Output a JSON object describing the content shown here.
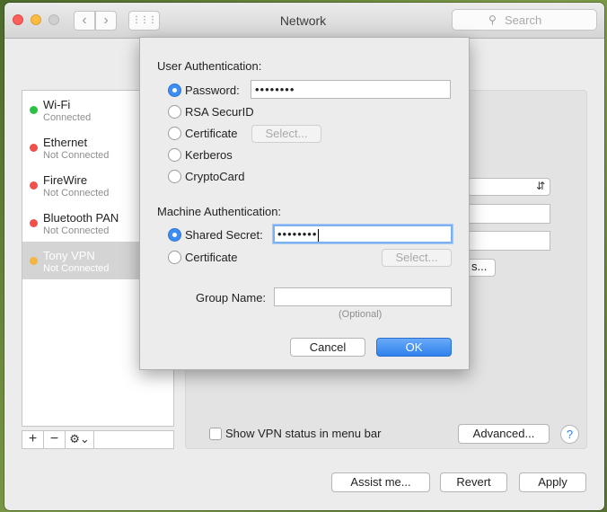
{
  "window": {
    "title": "Network"
  },
  "search": {
    "placeholder": "Search",
    "icon": "magnifier"
  },
  "toolbar": {
    "back": "‹",
    "forward": "›",
    "grid": "⋮⋮⋮"
  },
  "sidebar": {
    "items": [
      {
        "name": "Wi-Fi",
        "status": "Connected",
        "color": "#29c043"
      },
      {
        "name": "Ethernet",
        "status": "Not Connected",
        "color": "#f0504b"
      },
      {
        "name": "FireWire",
        "status": "Not Connected",
        "color": "#f0504b"
      },
      {
        "name": "Bluetooth PAN",
        "status": "Not Connected",
        "color": "#f0504b"
      },
      {
        "name": "Tony VPN",
        "status": "Not Connected",
        "color": "#f4b63f"
      }
    ],
    "footer": {
      "add": "+",
      "remove": "−",
      "gear": "⚙︎⌄"
    }
  },
  "panel": {
    "show_vpn_label": "Show VPN status in menu bar",
    "advanced_label": "Advanced...",
    "help_label": "?",
    "partial_button": "s..."
  },
  "footer": {
    "assist": "Assist me...",
    "revert": "Revert",
    "apply": "Apply"
  },
  "dialog": {
    "user_auth_heading": "User Authentication:",
    "user_options": [
      {
        "label": "Password:",
        "selected": true
      },
      {
        "label": "RSA SecurID",
        "selected": false
      },
      {
        "label": "Certificate",
        "selected": false
      },
      {
        "label": "Kerberos",
        "selected": false
      },
      {
        "label": "CryptoCard",
        "selected": false
      }
    ],
    "password_value": "••••••••",
    "certificate_select": "Select...",
    "machine_auth_heading": "Machine Authentication:",
    "machine_options": [
      {
        "label": "Shared Secret:",
        "selected": true
      },
      {
        "label": "Certificate",
        "selected": false
      }
    ],
    "shared_secret_value": "••••••••",
    "machine_cert_select": "Select...",
    "group_name_label": "Group Name:",
    "group_name_value": "",
    "group_name_hint": "(Optional)",
    "cancel": "Cancel",
    "ok": "OK"
  }
}
